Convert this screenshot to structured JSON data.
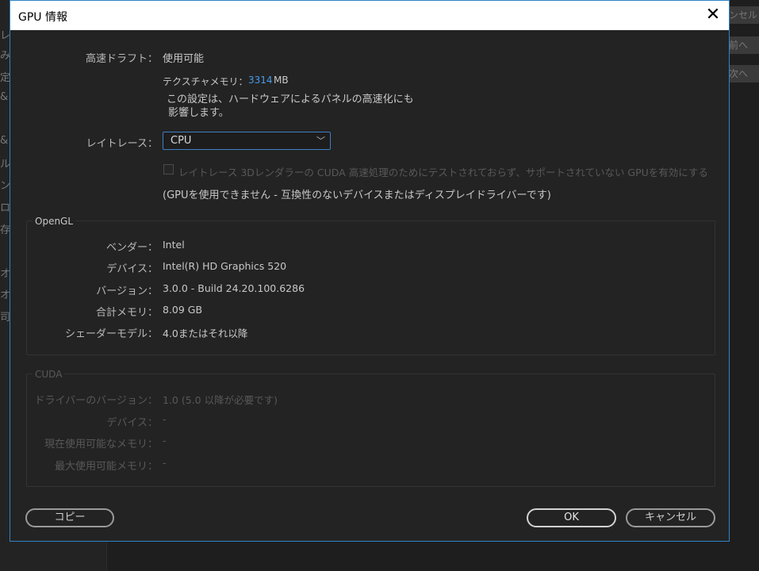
{
  "background": {
    "right_buttons": [
      "ンセル",
      "前へ",
      "次へ"
    ],
    "left_chars": [
      "レ",
      "み",
      "定",
      "&",
      "&",
      "ル",
      "ン",
      "ロ",
      "存",
      "オ",
      "オ",
      "司"
    ]
  },
  "dialog": {
    "title": "GPU 情報",
    "close_glyph": "✕",
    "draft": {
      "label": "高速ドラフト：",
      "value": "使用可能",
      "texture_label": "テクスチャメモリ：",
      "texture_value": "3314",
      "texture_unit": "MB",
      "note_line1": "この設定は、ハードウェアによるパネルの高速化にも",
      "note_line2": "影響します。"
    },
    "raytrace": {
      "label": "レイトレース：",
      "selected": "CPU",
      "checkbox_label": "レイトレース 3Dレンダラーの CUDA 高速処理のためにテストされておらず、サポートされていない GPUを有効にする",
      "checkbox_checked": false,
      "warning": "(GPUを使用できません - 互換性のないデバイスまたはディスプレイドライバーです)"
    },
    "opengl": {
      "title": "OpenGL",
      "rows": [
        {
          "label": "ベンダー：",
          "value": "Intel"
        },
        {
          "label": "デバイス：",
          "value": "Intel(R) HD Graphics 520"
        },
        {
          "label": "バージョン：",
          "value": "3.0.0 - Build 24.20.100.6286"
        },
        {
          "label": "合計メモリ：",
          "value": "8.09 GB"
        },
        {
          "label": "シェーダーモデル：",
          "value": "4.0またはそれ以降"
        }
      ]
    },
    "cuda": {
      "title": "CUDA",
      "rows": [
        {
          "label": "ドライバーのバージョン：",
          "value": "1.0 (5.0 以降が必要です)"
        },
        {
          "label": "デバイス：",
          "value": "-"
        },
        {
          "label": "現在使用可能なメモリ：",
          "value": "-"
        },
        {
          "label": "最大使用可能メモリ：",
          "value": "-"
        }
      ]
    },
    "buttons": {
      "copy": "コピー",
      "ok": "OK",
      "cancel": "キャンセル"
    },
    "colors": {
      "accent": "#2f83c9",
      "highlight_value": "#4a9be8"
    }
  }
}
